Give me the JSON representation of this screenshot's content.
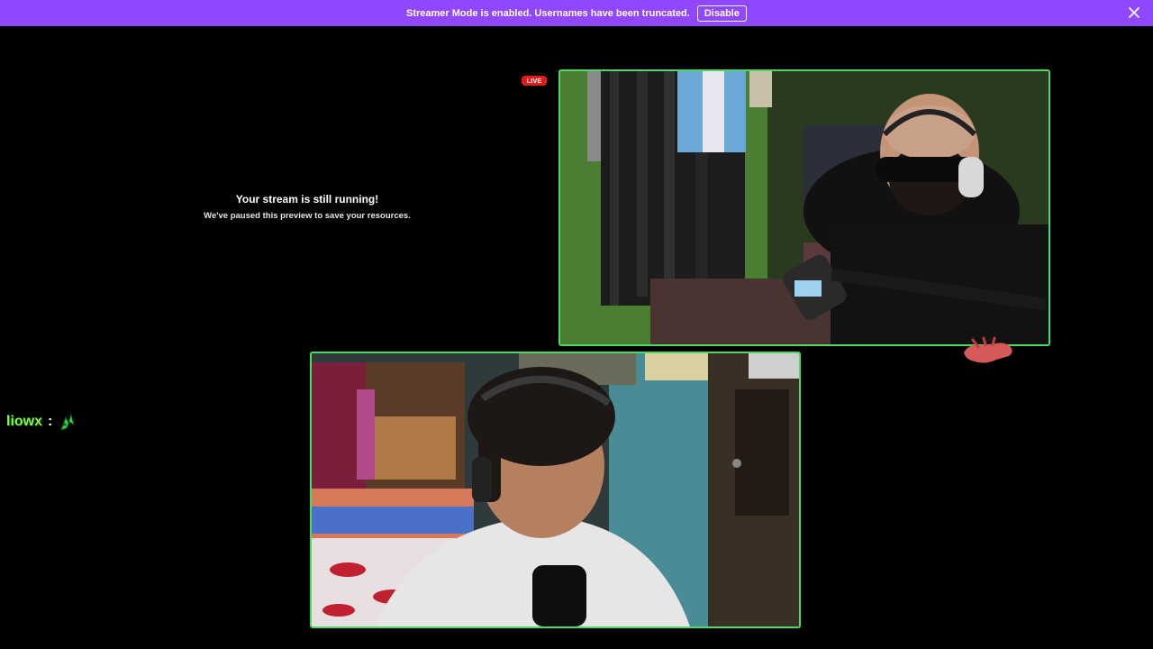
{
  "banner": {
    "message": "Streamer Mode is enabled. Usernames have been truncated.",
    "disable_label": "Disable",
    "close_icon": "close-icon",
    "color": "#9146ff"
  },
  "preview": {
    "title": "Your stream is still running!",
    "subtitle": "We've paused this preview to save your resources."
  },
  "live_badge": {
    "label": "LIVE",
    "color": "#e91916"
  },
  "cams": {
    "border_color": "#4cd964",
    "top": {
      "subject": "man with headphones and sunglasses at microphone"
    },
    "bottom": {
      "subject": "young man with headset in bedroom"
    }
  },
  "chat": {
    "username": "liowx",
    "separator": ":",
    "emote": "green-emote-icon",
    "username_color": "#7dff4d"
  },
  "overlay": {
    "sticker": "hand-sticker"
  }
}
